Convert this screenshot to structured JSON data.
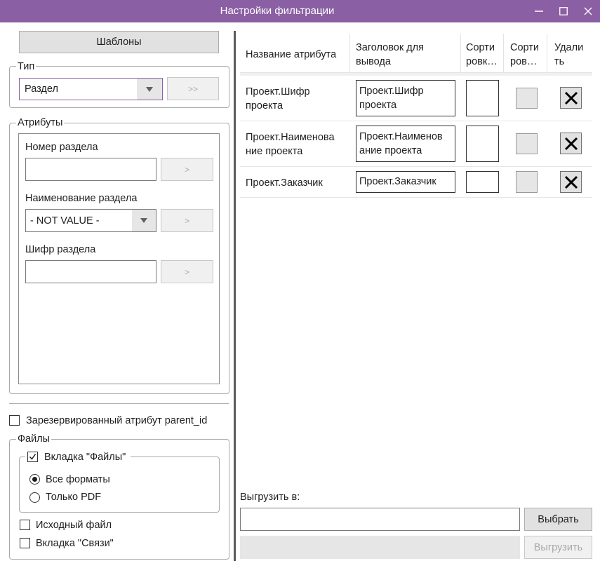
{
  "window": {
    "title": "Настройки фильтрации"
  },
  "left": {
    "templates_label": "Шаблоны",
    "type_group": {
      "legend": "Тип",
      "selected": "Раздел",
      "apply_label": ">>"
    },
    "attributes_group": {
      "legend": "Атрибуты",
      "fields": [
        {
          "label": "Номер раздела",
          "value": "",
          "apply_label": ">"
        },
        {
          "label": "Наименование раздела",
          "value": "- NOT VALUE -",
          "apply_label": ">"
        },
        {
          "label": "Шифр раздела",
          "value": "",
          "apply_label": ">"
        }
      ]
    },
    "reserved_checkbox": {
      "label": "Зарезервированный атрибут parent_id",
      "checked": false
    },
    "files_group": {
      "legend": "Файлы",
      "files_tab": {
        "label": "Вкладка \"Файлы\"",
        "checked": true
      },
      "radios": [
        {
          "label": "Все форматы",
          "selected": true
        },
        {
          "label": "Только PDF",
          "selected": false
        }
      ],
      "source_file": {
        "label": "Исходный файл",
        "checked": false
      },
      "links_tab": {
        "label": "Вкладка \"Связи\"",
        "checked": false
      }
    }
  },
  "table": {
    "headers": [
      "Название атрибута",
      "Заголовок для\nвывода",
      "Сорти\nровк…",
      "Сорти\nров…",
      "Удали\nть"
    ],
    "rows": [
      {
        "name": "Проект.Шифр\nпроекта",
        "header": "Проект.Шифр\nпроекта"
      },
      {
        "name": "Проект.Наименова\nние проекта",
        "header": "Проект.Наименов\nание проекта"
      },
      {
        "name": "Проект.Заказчик",
        "header": "Проект.Заказчик"
      }
    ]
  },
  "export": {
    "label": "Выгрузить в:",
    "path": "",
    "choose_label": "Выбрать",
    "export_label": "Выгрузить"
  }
}
